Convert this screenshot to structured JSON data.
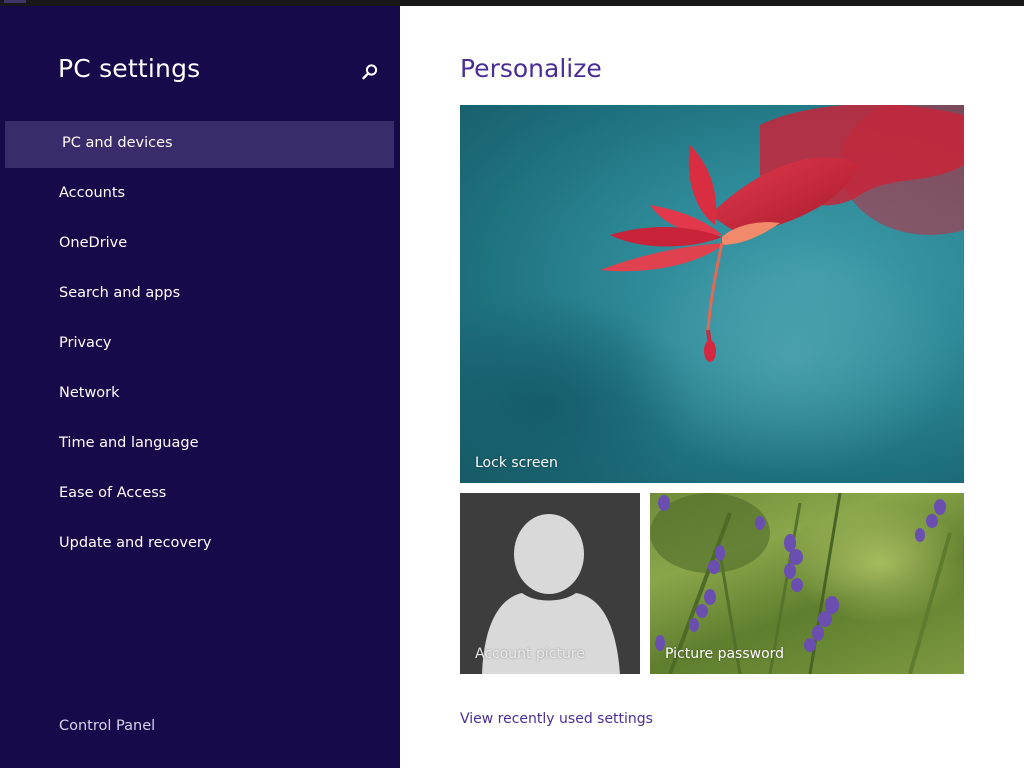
{
  "window": {
    "accent_color": "#3e3568"
  },
  "sidebar": {
    "title": "PC settings",
    "background_color": "#180a4a",
    "selected_color": "#3a2c6a",
    "search_icon": "search-icon",
    "items": [
      {
        "label": "PC and devices",
        "selected": true
      },
      {
        "label": "Accounts",
        "selected": false
      },
      {
        "label": "OneDrive",
        "selected": false
      },
      {
        "label": "Search and apps",
        "selected": false
      },
      {
        "label": "Privacy",
        "selected": false
      },
      {
        "label": "Network",
        "selected": false
      },
      {
        "label": "Time and language",
        "selected": false
      },
      {
        "label": "Ease of Access",
        "selected": false
      },
      {
        "label": "Update and recovery",
        "selected": false
      }
    ],
    "footer_link": "Control Panel"
  },
  "main": {
    "title": "Personalize",
    "title_color": "#4a2e96",
    "tiles": {
      "lock_screen": {
        "label": "Lock screen"
      },
      "account_picture": {
        "label": "Account picture"
      },
      "picture_password": {
        "label": "Picture password"
      }
    },
    "recent_link": "View recently used settings"
  }
}
